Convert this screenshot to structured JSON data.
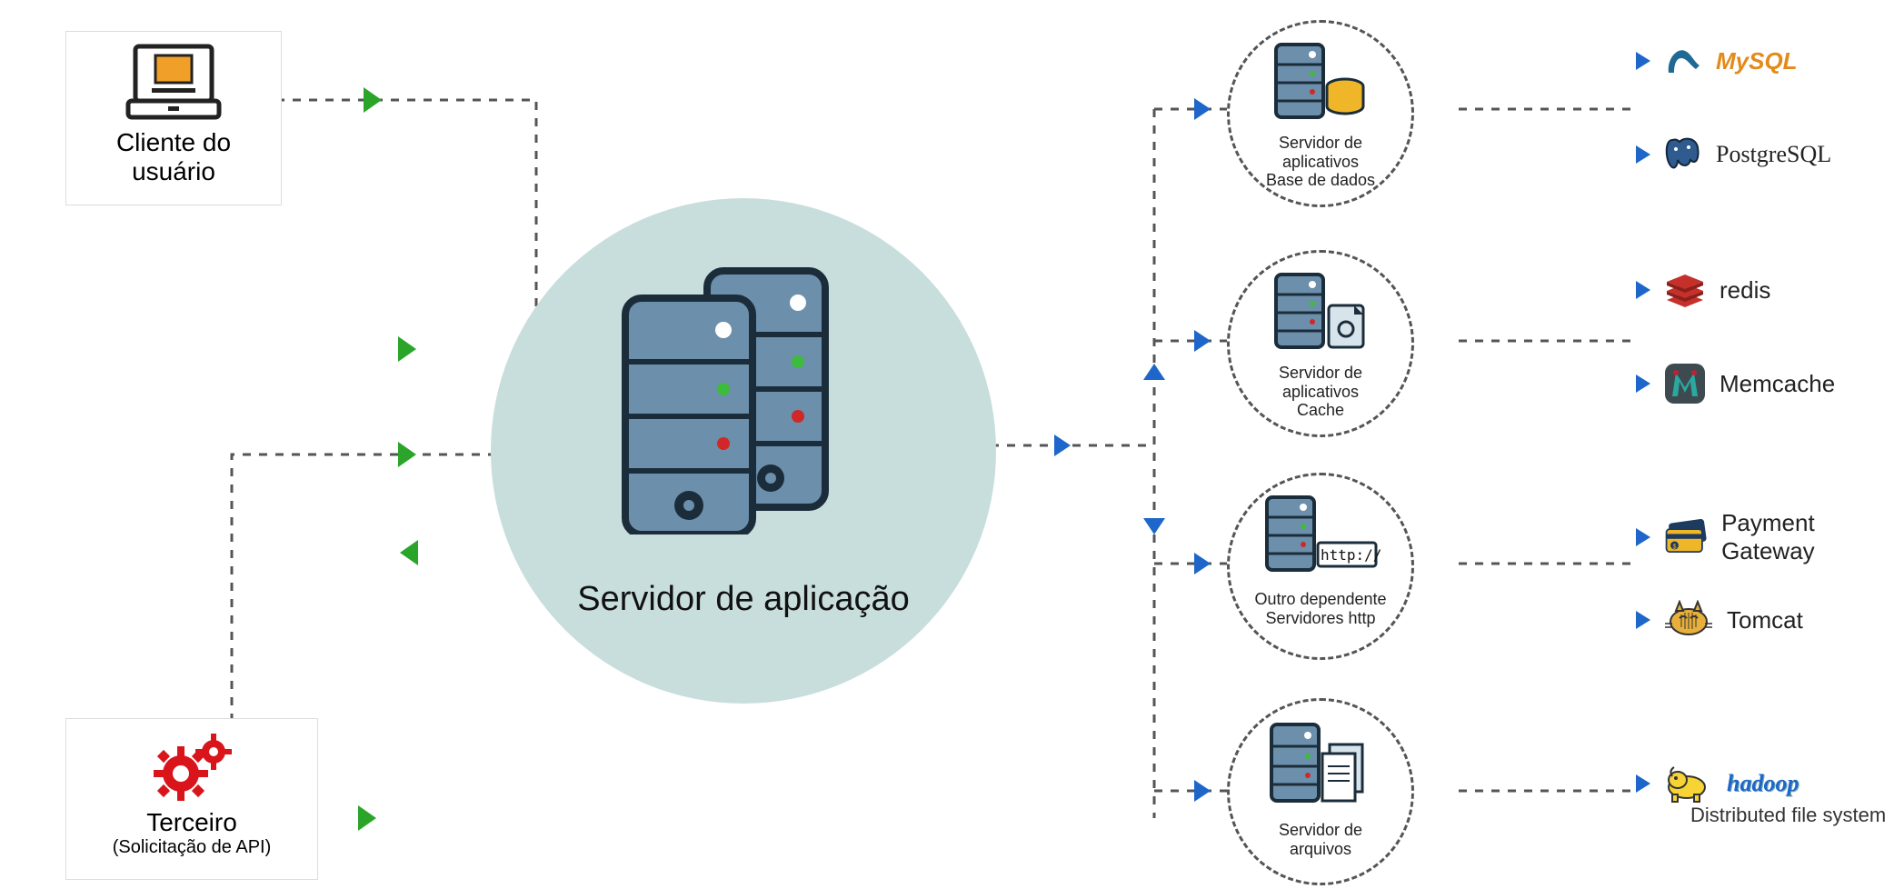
{
  "clients": {
    "user": {
      "title_l1": "Cliente do",
      "title_l2": "usuário"
    },
    "third_party": {
      "title": "Terceiro",
      "subtitle": "(Solicitação de API)"
    }
  },
  "center": {
    "label": "Servidor de aplicação"
  },
  "services": {
    "db": {
      "l1": "Servidor de",
      "l2": "aplicativos",
      "l3": "Base de dados"
    },
    "cache": {
      "l1": "Servidor de",
      "l2": "aplicativos",
      "l3": "Cache"
    },
    "http": {
      "l1": "Outro dependente",
      "l2": "Servidores http",
      "badge": "http://"
    },
    "file": {
      "l1": "Servidor de",
      "l2": "arquivos"
    }
  },
  "tech": {
    "mysql": "MySQL",
    "postgres": "PostgreSQL",
    "redis": "redis",
    "memcache": "Memcache",
    "payment": "Payment Gateway",
    "tomcat": "Tomcat",
    "hadoop": "hadoop",
    "hadoop_sub": "Distributed file system"
  }
}
